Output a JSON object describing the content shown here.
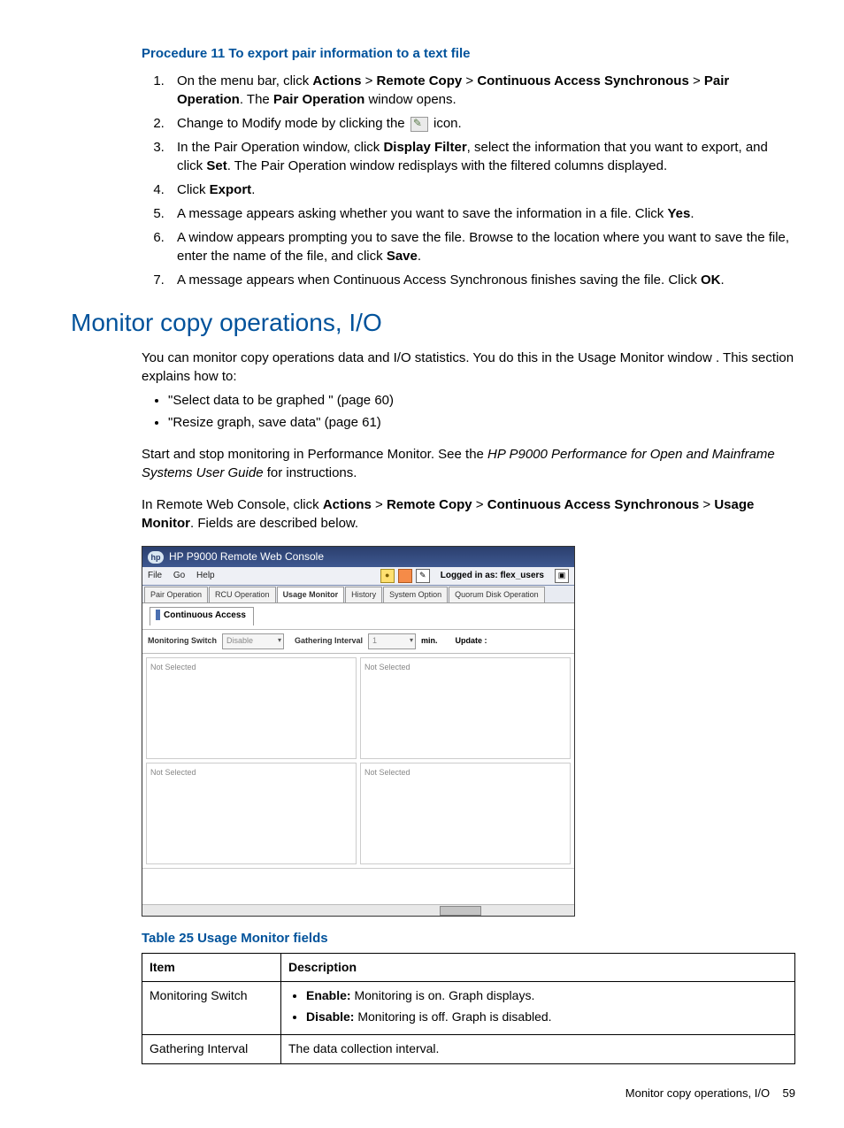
{
  "procedure": {
    "title": "Procedure 11 To export pair information to a text file",
    "steps": {
      "s1_pre": "On the menu bar, click ",
      "s1_b1": "Actions",
      "s1_gt": " > ",
      "s1_b2": "Remote Copy",
      "s1_b3": "Continuous Access Synchronous",
      "s1_b4": "Pair Operation",
      "s1_mid": ". The ",
      "s1_b5": "Pair Operation",
      "s1_post": " window opens.",
      "s2_pre": "Change to Modify mode by clicking the ",
      "s2_post": " icon.",
      "s3_pre": "In the Pair Operation window, click ",
      "s3_b1": "Display Filter",
      "s3_mid": ", select the information that you want to export, and click ",
      "s3_b2": "Set",
      "s3_post": ". The Pair Operation window redisplays with the filtered columns displayed.",
      "s4_pre": "Click ",
      "s4_b1": "Export",
      "s4_post": ".",
      "s5_pre": "A message appears asking whether you want to save the information in a file. Click ",
      "s5_b1": "Yes",
      "s5_post": ".",
      "s6_pre": "A window appears prompting you to save the file. Browse to the location where you want to save the file, enter the name of the file, and click ",
      "s6_b1": "Save",
      "s6_post": ".",
      "s7_pre": "A message appears when Continuous Access Synchronous finishes saving the file. Click ",
      "s7_b1": "OK",
      "s7_post": "."
    }
  },
  "section": {
    "title": "Monitor copy operations, I/O",
    "intro": "You can monitor copy operations data and I/O statistics. You do this in the Usage Monitor window . This section explains how to:",
    "bullet1": "\"Select data to be graphed \" (page 60)",
    "bullet2": "\"Resize graph, save data\" (page 61)",
    "p2_pre": "Start and stop monitoring in Performance Monitor. See the ",
    "p2_i": "HP P9000 Performance for Open and Mainframe Systems User Guide",
    "p2_post": " for instructions.",
    "p3_pre": "In Remote Web Console, click ",
    "p3_b1": "Actions",
    "p3_gt": " > ",
    "p3_b2": "Remote Copy",
    "p3_b3": "Continuous Access Synchronous",
    "p3_b4": "Usage Monitor",
    "p3_post": ". Fields are described below."
  },
  "mock": {
    "title": "HP P9000 Remote Web Console",
    "menu": {
      "file": "File",
      "go": "Go",
      "help": "Help"
    },
    "logged_in": "Logged in as: flex_users",
    "tabs": {
      "pair_op": "Pair Operation",
      "rcu_op": "RCU Operation",
      "usage_mon": "Usage Monitor",
      "history": "History",
      "sys_opt": "System Option",
      "quorum": "Quorum Disk Operation"
    },
    "subtab": "Continuous Access",
    "toolbar": {
      "mon_switch": "Monitoring Switch",
      "mon_value": "Disable",
      "gather": "Gathering Interval",
      "gather_val": "1",
      "min": "min.",
      "update": "Update :"
    },
    "panel_text": "Not Selected"
  },
  "table": {
    "title": "Table 25 Usage Monitor fields",
    "headers": {
      "item": "Item",
      "desc": "Description"
    },
    "rows": {
      "r1": {
        "item": "Monitoring Switch",
        "d1_b": "Enable:",
        "d1_t": " Monitoring is on. Graph displays.",
        "d2_b": "Disable:",
        "d2_t": " Monitoring is off. Graph is disabled."
      },
      "r2": {
        "item": "Gathering Interval",
        "desc": "The data collection interval."
      }
    }
  },
  "footer": {
    "text": "Monitor copy operations, I/O",
    "page": "59"
  }
}
